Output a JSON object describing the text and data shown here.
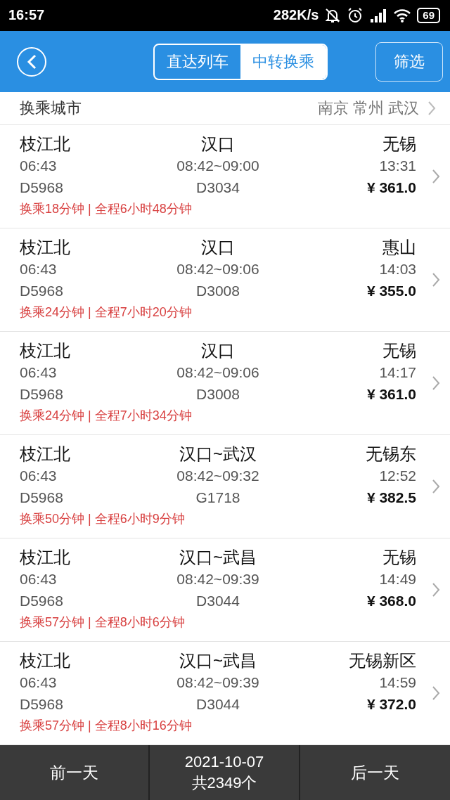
{
  "status_bar": {
    "time": "16:57",
    "speed": "282K/s",
    "battery": "69"
  },
  "header": {
    "tabs": [
      {
        "label": "直达列车",
        "selected": false
      },
      {
        "label": "中转换乘",
        "selected": true
      }
    ],
    "filter": "筛选"
  },
  "transfer_city": {
    "label": "换乘城市",
    "value": "南京 常州 武汉"
  },
  "routes": [
    {
      "from": "枝江北",
      "via": "汉口",
      "to": "无锡",
      "depart": "06:43",
      "transfer_time": "08:42~09:00",
      "arrive": "13:31",
      "train_1": "D5968",
      "train_2": "D3034",
      "price": "¥ 361.0",
      "summary": "换乘18分钟 | 全程6小时48分钟"
    },
    {
      "from": "枝江北",
      "via": "汉口",
      "to": "惠山",
      "depart": "06:43",
      "transfer_time": "08:42~09:06",
      "arrive": "14:03",
      "train_1": "D5968",
      "train_2": "D3008",
      "price": "¥ 355.0",
      "summary": "换乘24分钟 | 全程7小时20分钟"
    },
    {
      "from": "枝江北",
      "via": "汉口",
      "to": "无锡",
      "depart": "06:43",
      "transfer_time": "08:42~09:06",
      "arrive": "14:17",
      "train_1": "D5968",
      "train_2": "D3008",
      "price": "¥ 361.0",
      "summary": "换乘24分钟 | 全程7小时34分钟"
    },
    {
      "from": "枝江北",
      "via": "汉口~武汉",
      "to": "无锡东",
      "depart": "06:43",
      "transfer_time": "08:42~09:32",
      "arrive": "12:52",
      "train_1": "D5968",
      "train_2": "G1718",
      "price": "¥ 382.5",
      "summary": "换乘50分钟 | 全程6小时9分钟"
    },
    {
      "from": "枝江北",
      "via": "汉口~武昌",
      "to": "无锡",
      "depart": "06:43",
      "transfer_time": "08:42~09:39",
      "arrive": "14:49",
      "train_1": "D5968",
      "train_2": "D3044",
      "price": "¥ 368.0",
      "summary": "换乘57分钟 | 全程8小时6分钟"
    },
    {
      "from": "枝江北",
      "via": "汉口~武昌",
      "to": "无锡新区",
      "depart": "06:43",
      "transfer_time": "08:42~09:39",
      "arrive": "14:59",
      "train_1": "D5968",
      "train_2": "D3044",
      "price": "¥ 372.0",
      "summary": "换乘57分钟 | 全程8小时16分钟"
    }
  ],
  "bottom_bar": {
    "prev": "前一天",
    "date": "2021-10-07",
    "count": "共2349个",
    "next": "后一天"
  }
}
